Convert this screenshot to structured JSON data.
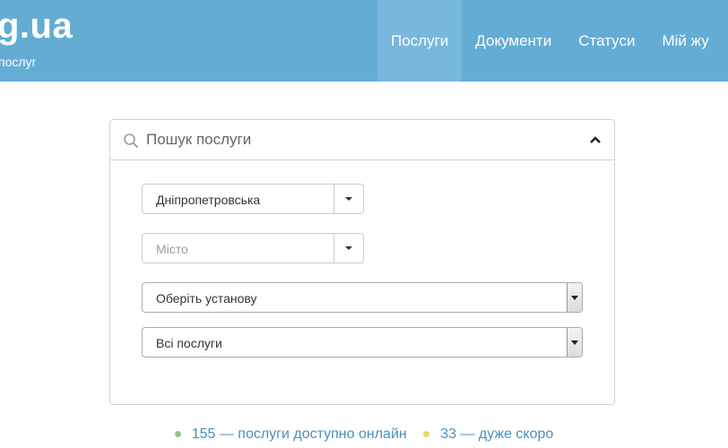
{
  "header": {
    "logo_text": "g.ua",
    "tagline": "послуг",
    "nav": [
      {
        "label": "Послуги",
        "active": true
      },
      {
        "label": "Документи",
        "active": false
      },
      {
        "label": "Статуси",
        "active": false
      },
      {
        "label": "Мій жу",
        "active": false
      }
    ]
  },
  "search": {
    "placeholder": "Пошук послуги"
  },
  "filters": {
    "region": {
      "value": "Дніпропетровська"
    },
    "city": {
      "placeholder": "Місто"
    },
    "institution": {
      "value": "Оберіть установу"
    },
    "services": {
      "value": "Всі послуги"
    }
  },
  "stats": {
    "online": {
      "text": "155 — послуги доступно онлайн",
      "dot_color": "#8cc77e"
    },
    "soon": {
      "text": "33 — дуже скоро",
      "dot_color": "#f2d468"
    }
  },
  "colors": {
    "header_bg": "#65acd4",
    "nav_active_bg": "#78b8dd",
    "link": "#4b8fbf"
  },
  "icons": {
    "search": "search-icon",
    "collapse": "chevron-up-icon",
    "dropdown": "caret-down-icon"
  }
}
